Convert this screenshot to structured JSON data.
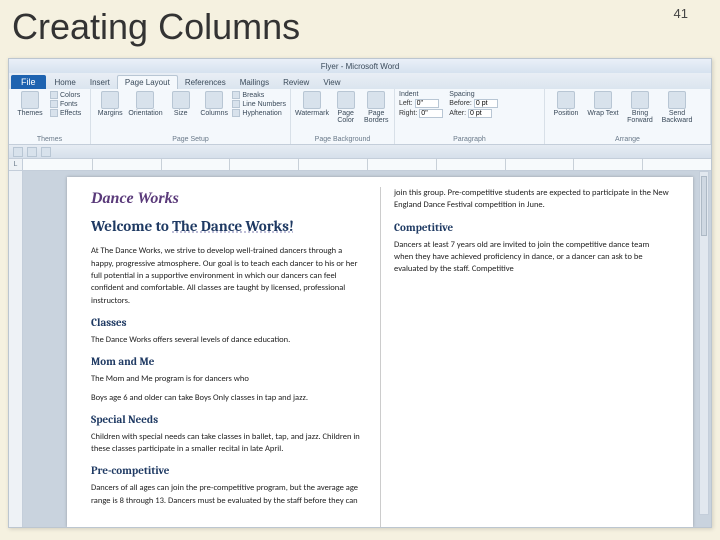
{
  "slide": {
    "title": "Creating Columns",
    "number": "41"
  },
  "window": {
    "title": "Flyer - Microsoft Word"
  },
  "tabs": {
    "file": "File",
    "items": [
      "Home",
      "Insert",
      "Page Layout",
      "References",
      "Mailings",
      "Review",
      "View"
    ],
    "active_index": 2
  },
  "ribbon": {
    "themes": {
      "label": "Themes",
      "btn": "Themes",
      "colors": "Colors",
      "fonts": "Fonts",
      "effects": "Effects"
    },
    "page_setup": {
      "label": "Page Setup",
      "margins": "Margins",
      "orientation": "Orientation",
      "size": "Size",
      "columns": "Columns",
      "breaks": "Breaks",
      "line_numbers": "Line Numbers",
      "hyphenation": "Hyphenation"
    },
    "page_background": {
      "label": "Page Background",
      "watermark": "Watermark",
      "page_color": "Page Color",
      "page_borders": "Page Borders"
    },
    "paragraph": {
      "label": "Paragraph",
      "indent": "Indent",
      "spacing": "Spacing",
      "left_label": "Left:",
      "right_label": "Right:",
      "before_label": "Before:",
      "after_label": "After:",
      "left": "0\"",
      "right": "0\"",
      "before": "0 pt",
      "after": "0 pt"
    },
    "arrange": {
      "label": "Arrange",
      "position": "Position",
      "wrap": "Wrap Text",
      "bring": "Bring Forward",
      "send": "Send Backward"
    }
  },
  "ruler": {
    "corner": "L"
  },
  "document": {
    "title": "Dance Works",
    "h1a": "Welcome to ",
    "h1b_underlined": "The Dance Works!",
    "p1": "At The Dance Works, we strive to develop well-trained dancers through a happy, progressive atmosphere. Our goal is to teach each dancer to his or her full potential in a supportive environment in which our dancers can feel confident and comfortable. All classes are taught by licensed, professional instructors.",
    "h2_classes": "Classes",
    "p_classes": "The Dance Works offers several levels of dance education.",
    "h2_mom": "Mom and Me",
    "p_mom": "The Mom and Me program is for dancers who",
    "p_boys": "Boys age 6 and older can take Boys Only classes in tap and jazz.",
    "h2_special": "Special Needs",
    "p_special": "Children with special needs can take classes in ballet, tap, and jazz. Children in these classes participate in a smaller recital in late April.",
    "h2_precomp": "Pre-competitive",
    "p_precomp": "Dancers of all ages can join the pre-competitive program, but the average age range is 8 through 13. Dancers must be evaluated by the staff before they can join this group. Pre-competitive students are expected to participate in the New England Dance Festival competition in June.",
    "h2_comp": "Competitive",
    "p_comp": "Dancers at least 7 years old are invited to join the competitive dance team when they have achieved proficiency in dance, or a dancer can ask to be evaluated by the staff. Competitive"
  }
}
